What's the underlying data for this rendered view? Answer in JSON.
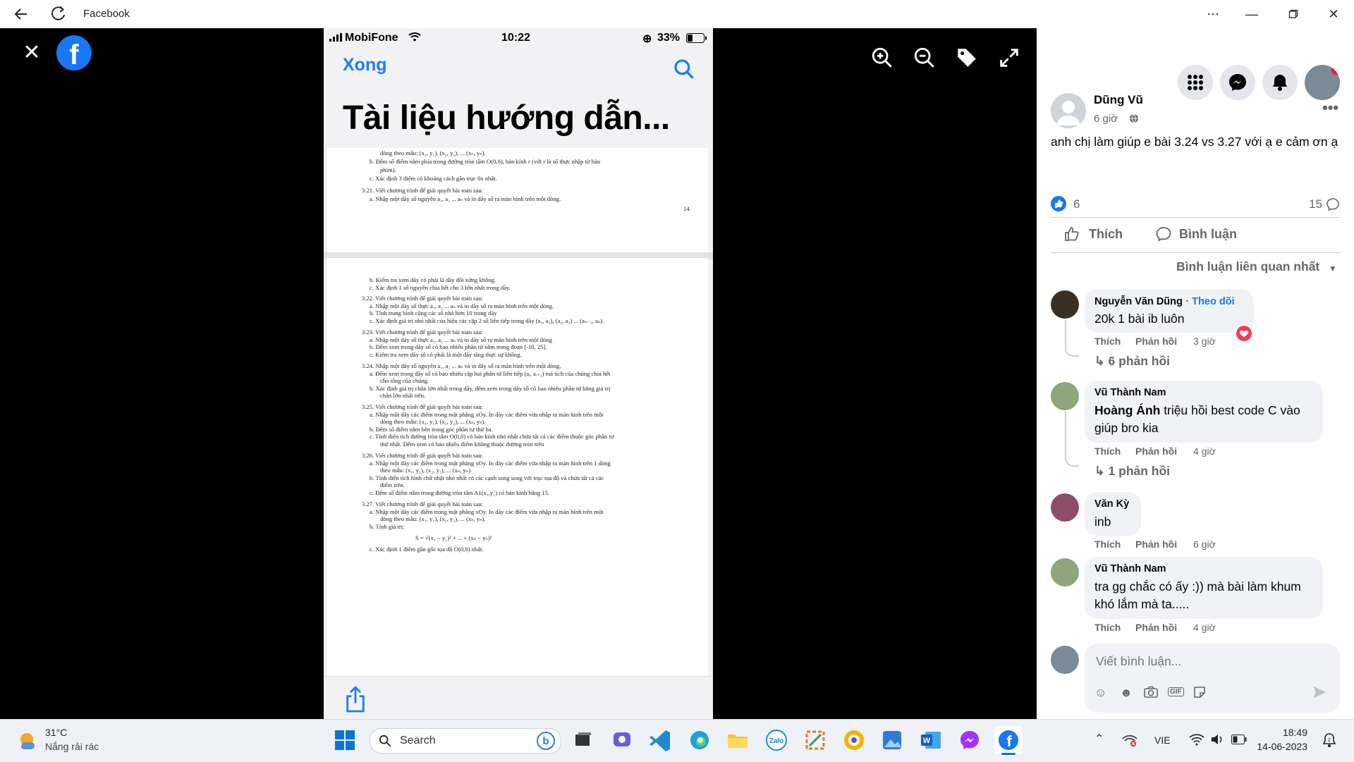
{
  "window": {
    "title": "Facebook"
  },
  "phone": {
    "carrier": "MobiFone",
    "time": "10:22",
    "battery": "33%",
    "done_label": "Xong",
    "doc_title": "Tài liệu hướng dẫn...",
    "page1_lines": [
      "dòng theo mẫu: (x₁, y₁), (x₂, y₂), ... (xₙ, yₙ).",
      "b.  Đếm số điểm nằm phía trong đường tròn tâm O(0,0), bán kính r (với r là số thực nhập từ bàn",
      "phím).",
      "c.  Xác định 3 điểm có khoảng cách gần trục 0x nhất.",
      "3.21. Viết chương trình  để giải quyết bài toán sau:",
      "a.  Nhập một dãy số nguyên a₁, a₂ ... aₙ và in dãy số ra màn hình trên một dòng."
    ],
    "page1_number": "14",
    "page2_lines": [
      "b.  Kiểm tra xem dãy có phải là dãy đối xứng không.",
      "c.  Xác định 1 số nguyên chia hết cho 3 lớn nhất trong dãy.",
      "3.22. Viết chương trình  để giải quyết bài toán sau:",
      "a.  Nhập một dãy số thực a₁, a₂ ... aₙ và in dãy số ra màn hình trên một dòng.",
      "b.  Tính trung bình cộng các số nhỏ hơn 10 trong dãy",
      "c.  Xác định giá trị nhỏ nhất của hiệu các cặp 2 số liên tiếp trong dãy (a₁, a₂), (a₂, a₃) ... (aₙ₋₁, aₙ).",
      "3.23. Viết chương trình  để giải quyết bài toán sau:",
      "a.  Nhập một dãy số thực a₁, a₂ ... aₙ và in dãy số ra màn hình trên một dòng",
      "b.  Đếm xem trong dãy số có bao nhiêu phần tử nằm trong đoạn [-10, 25].",
      "c.  Kiểm tra xem dãy số có phải là một dãy tăng thực sự không.",
      "3.24. Nhập một dãy số nguyên a₁, a₂ ... aₙ và in dãy số ra màn hình trên một dòng.",
      "a.  Đếm xem trong dãy số có bao nhiêu cặp hai phần tử liên tiếp (aᵢ, aᵢ₊₁) mà tích của chúng chia hết",
      "cho tổng của chúng.",
      "b.  Xác định giá trị chẵn lớn nhất trong dãy, đếm xem trong dãy số có bao nhiêu phần tử bằng giá trị",
      "chẵn lớn nhất trên.",
      "3.25. Viết chương trình  để giải quyết bài toán sau:",
      "a.  Nhập một dãy các điểm trong mặt phẳng xOy. In dãy các điểm vừa nhập ra màn hình trên một",
      "dòng theo mẫu: (x₁, y₁), (x₂, y₂), ... (xₙ, yₙ).",
      "b.  Đếm số điểm nằm bên trong góc phần tư thứ ba.",
      "c.  Tính diện tích đường tròn tâm O(0,0) có bán kính nhỏ nhất chứa tất cả các điểm thuộc góc phần tư",
      "thứ nhất. Đếm xem có bao nhiêu điểm không thuộc đường tròn trên",
      "3.26. Viết chương trình  để giải quyết bài toán sau:",
      "a.  Nhập một dãy các điểm trong mặt phẳng xOy. In dãy các điểm vừa nhập ra màn hình trên 1 dòng",
      "theo mẫu: (x₁, y₁), (x₂, y₂), ... (xₙ, yₙ).",
      "b.  Tính diện tích hình chữ nhật nhỏ nhất có các cạnh song song với trục tọa độ và chứa tất cả các",
      "điểm trên.",
      "c.  Đếm số điểm nằm trong đường tròn tâm A1(x₁,y₁) có bán kính bằng 15.",
      "3.27. Viết chương trình  để giải quyết bài toán sau:",
      "a.  Nhập một dãy các điểm trong mặt phẳng xOy. In dãy các điểm vừa nhập ra màn hình trên một",
      "dòng theo mẫu: (x₁, y₁), (x₂, y₂), ... (xₙ, yₙ).",
      "b.  Tính giá trị:",
      "S = √(x₁ − y₁)² + ... + (xₙ − yₙ)²",
      "c.  Xác định 1 điểm gần gốc tọa độ O(0,0) nhất."
    ]
  },
  "post": {
    "author": "Dũng Vũ",
    "time": "6 giờ",
    "text": "anh chị làm giúp e bài 3.24 vs 3.27 với ạ e cảm ơn ạ",
    "reaction_count": "6",
    "comment_count": "15",
    "like_label": "Thích",
    "comment_label": "Bình luận",
    "sort_label": "Bình luận liên quan nhất"
  },
  "comments": [
    {
      "name": "Nguyễn Văn Dũng",
      "follow": "· Theo dõi",
      "text": "20k 1 bài ib luôn",
      "like": "Thích",
      "reply": "Phản hồi",
      "time": "3 giờ",
      "replies": "6 phản hồi"
    },
    {
      "name": "Vũ Thành Nam",
      "mention": "Hoàng Ánh",
      "text": " triệu hồi best code C vào giúp bro kia",
      "like": "Thích",
      "reply": "Phản hồi",
      "time": "4 giờ",
      "replies": "1 phản hồi"
    },
    {
      "name": "Văn Kỳ",
      "text": "inb",
      "like": "Thích",
      "reply": "Phản hồi",
      "time": "6 giờ"
    },
    {
      "name": "Vũ Thành Nam",
      "text": "tra gg chắc có ấy :)) mà bài làm khum khó lắm mà ta.....",
      "like": "Thích",
      "reply": "Phản hồi",
      "time": "4 giờ"
    }
  ],
  "composer": {
    "placeholder": "Viết bình luận..."
  },
  "taskbar": {
    "weather_temp": "31°C",
    "weather_desc": "Nắng rải rác",
    "search_label": "Search",
    "lang": "VIE",
    "clock_time": "18:49",
    "clock_date": "14-06-2023"
  },
  "colors": {
    "brand": "#1877f2",
    "link": "#1f7ef0"
  }
}
